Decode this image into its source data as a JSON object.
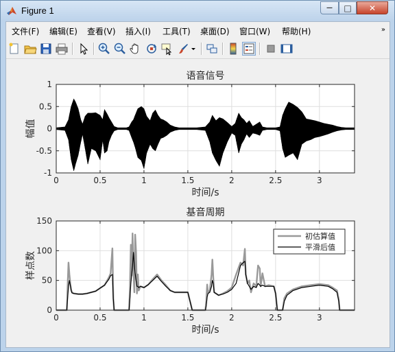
{
  "window": {
    "title": "Figure 1",
    "minimize_glyph": "—",
    "maximize_glyph": "□",
    "close_glyph": "✕"
  },
  "menu": [
    "文件(F)",
    "编辑(E)",
    "查看(V)",
    "插入(I)",
    "工具(T)",
    "桌面(D)",
    "窗口(W)",
    "帮助(H)"
  ],
  "menu_overflow_glyph": "»",
  "toolbar_icons": [
    "new-figure-icon",
    "open-file-icon",
    "save-icon",
    "print-icon",
    "edit-plot-arrow-icon",
    "zoom-in-icon",
    "zoom-out-icon",
    "pan-hand-icon",
    "rotate-3d-icon",
    "data-cursor-icon",
    "brush-icon",
    "link-plot-icon",
    "colorbar-icon",
    "legend-icon",
    "hide-plot-tools-icon",
    "show-plot-tools-icon"
  ],
  "chart_data": [
    {
      "type": "line",
      "title": "语音信号",
      "xlabel": "时间/s",
      "ylabel": "幅值",
      "xlim": [
        0,
        3.4
      ],
      "ylim": [
        -1,
        1
      ],
      "xticks": [
        0,
        0.5,
        1,
        1.5,
        2,
        2.5,
        3
      ],
      "xtick_labels": [
        "0",
        "0.5",
        "1",
        "1.5",
        "2",
        "2.5",
        "3"
      ],
      "yticks": [
        -1,
        -0.5,
        0,
        0.5,
        1
      ],
      "ytick_labels": [
        "-1",
        "-0.5",
        "0",
        "0.5",
        "1"
      ],
      "grid": true,
      "series_color": "#000000",
      "envelope": {
        "t": [
          0,
          0.1,
          0.14,
          0.17,
          0.2,
          0.22,
          0.25,
          0.28,
          0.3,
          0.33,
          0.36,
          0.4,
          0.45,
          0.5,
          0.53,
          0.55,
          0.58,
          0.6,
          0.63,
          0.66,
          0.7,
          0.75,
          0.8,
          0.83,
          0.86,
          0.88,
          0.9,
          0.93,
          0.97,
          1.0,
          1.03,
          1.07,
          1.1,
          1.13,
          1.16,
          1.19,
          1.22,
          1.26,
          1.3,
          1.35,
          1.4,
          1.5,
          1.6,
          1.7,
          1.75,
          1.78,
          1.82,
          1.86,
          1.9,
          1.95,
          2.0,
          2.04,
          2.08,
          2.11,
          2.14,
          2.17,
          2.2,
          2.24,
          2.28,
          2.32,
          2.35,
          2.4,
          2.5,
          2.55,
          2.58,
          2.61,
          2.65,
          2.7,
          2.75,
          2.8,
          2.85,
          2.9,
          2.95,
          3.0,
          3.05,
          3.1,
          3.15,
          3.2,
          3.25,
          3.3,
          3.4
        ],
        "upper": [
          0.02,
          0.04,
          0.2,
          0.5,
          0.67,
          0.6,
          0.45,
          0.2,
          0.1,
          0.28,
          0.35,
          0.35,
          0.36,
          0.3,
          0.2,
          0.43,
          0.33,
          0.25,
          0.15,
          0.05,
          0.02,
          0.02,
          0.02,
          0.04,
          0.15,
          0.2,
          0.3,
          0.45,
          0.5,
          0.45,
          0.28,
          0.18,
          0.35,
          0.42,
          0.3,
          0.22,
          0.2,
          0.15,
          0.08,
          0.04,
          0.02,
          0.02,
          0.02,
          0.04,
          0.15,
          0.3,
          0.18,
          0.25,
          0.22,
          0.14,
          0.05,
          0.12,
          0.35,
          0.25,
          0.2,
          0.12,
          0.18,
          0.05,
          0.1,
          0.15,
          0.04,
          0.02,
          0.02,
          0.04,
          0.3,
          0.45,
          0.6,
          0.55,
          0.48,
          0.38,
          0.22,
          0.2,
          0.18,
          0.15,
          0.12,
          0.1,
          0.08,
          0.05,
          0.03,
          0.02,
          0.02
        ],
        "lower": [
          -0.02,
          -0.04,
          -0.25,
          -0.7,
          -0.95,
          -0.8,
          -0.6,
          -0.3,
          -0.12,
          -0.45,
          -0.8,
          -0.45,
          -0.5,
          -0.7,
          -0.25,
          -0.55,
          -0.5,
          -0.3,
          -0.15,
          -0.05,
          -0.02,
          -0.02,
          -0.02,
          -0.04,
          -0.2,
          -0.3,
          -0.42,
          -0.65,
          -0.72,
          -0.9,
          -0.55,
          -0.35,
          -0.45,
          -0.5,
          -0.35,
          -0.22,
          -0.2,
          -0.15,
          -0.08,
          -0.04,
          -0.02,
          -0.02,
          -0.02,
          -0.04,
          -0.3,
          -0.55,
          -0.72,
          -0.85,
          -0.55,
          -0.3,
          -0.1,
          -0.15,
          -0.55,
          -0.35,
          -0.25,
          -0.12,
          -0.2,
          -0.1,
          -0.12,
          -0.15,
          -0.04,
          -0.02,
          -0.02,
          -0.05,
          -0.45,
          -0.65,
          -0.6,
          -0.55,
          -0.7,
          -0.35,
          -0.28,
          -0.25,
          -0.2,
          -0.18,
          -0.15,
          -0.12,
          -0.08,
          -0.05,
          -0.03,
          -0.02,
          -0.02
        ]
      }
    },
    {
      "type": "line",
      "title": "基音周期",
      "xlabel": "时间/s",
      "ylabel": "样点数",
      "xlim": [
        0,
        3.4
      ],
      "ylim": [
        0,
        150
      ],
      "xticks": [
        0,
        0.5,
        1,
        1.5,
        2,
        2.5,
        3
      ],
      "xtick_labels": [
        "0",
        "0.5",
        "1",
        "1.5",
        "2",
        "2.5",
        "3"
      ],
      "yticks": [
        0,
        50,
        100,
        150
      ],
      "ytick_labels": [
        "0",
        "50",
        "100",
        "150"
      ],
      "grid": true,
      "legend_position": "top-right",
      "series": [
        {
          "name": "初估算值",
          "color": "#999999",
          "x": [
            0,
            0.12,
            0.13,
            0.14,
            0.15,
            0.16,
            0.17,
            0.18,
            0.2,
            0.25,
            0.3,
            0.35,
            0.4,
            0.45,
            0.5,
            0.55,
            0.6,
            0.62,
            0.64,
            0.65,
            0.66,
            0.67,
            0.7,
            0.8,
            0.83,
            0.84,
            0.85,
            0.86,
            0.87,
            0.88,
            0.89,
            0.9,
            0.91,
            0.92,
            0.93,
            0.94,
            0.96,
            1.0,
            1.05,
            1.1,
            1.15,
            1.2,
            1.25,
            1.3,
            1.35,
            1.4,
            1.45,
            1.5,
            1.55,
            1.7,
            1.71,
            1.72,
            1.73,
            1.75,
            1.77,
            1.78,
            1.79,
            1.8,
            1.85,
            1.9,
            1.95,
            2.0,
            2.05,
            2.1,
            2.13,
            2.15,
            2.16,
            2.18,
            2.2,
            2.22,
            2.25,
            2.28,
            2.3,
            2.32,
            2.33,
            2.35,
            2.38,
            2.42,
            2.48,
            2.5,
            2.52,
            2.53,
            2.55,
            2.57,
            2.58,
            2.6,
            2.63,
            2.7,
            2.8,
            2.9,
            3.0,
            3.1,
            3.15,
            3.2,
            3.22,
            3.23,
            3.24,
            3.4
          ],
          "y": [
            0,
            0,
            40,
            80,
            60,
            45,
            34,
            30,
            28,
            27,
            27,
            28,
            30,
            32,
            37,
            42,
            55,
            62,
            104,
            20,
            0,
            0,
            0,
            0,
            0,
            40,
            110,
            58,
            129,
            65,
            30,
            127,
            98,
            28,
            60,
            33,
            40,
            38,
            43,
            52,
            60,
            50,
            42,
            33,
            30,
            30,
            30,
            30,
            0,
            0,
            16,
            43,
            30,
            33,
            60,
            85,
            55,
            30,
            25,
            28,
            32,
            38,
            60,
            80,
            75,
            103,
            60,
            45,
            50,
            30,
            45,
            40,
            75,
            70,
            40,
            62,
            40,
            42,
            40,
            28,
            0,
            0,
            0,
            0,
            0,
            20,
            28,
            35,
            40,
            42,
            44,
            42,
            38,
            33,
            18,
            0,
            0,
            0
          ]
        },
        {
          "name": "平滑后值",
          "color": "#000000",
          "x": [
            0,
            0.12,
            0.13,
            0.14,
            0.15,
            0.16,
            0.17,
            0.18,
            0.2,
            0.25,
            0.3,
            0.35,
            0.4,
            0.45,
            0.5,
            0.55,
            0.6,
            0.62,
            0.64,
            0.65,
            0.66,
            0.67,
            0.7,
            0.8,
            0.83,
            0.84,
            0.85,
            0.86,
            0.87,
            0.88,
            0.89,
            0.9,
            0.91,
            0.92,
            0.93,
            0.94,
            0.96,
            1.0,
            1.05,
            1.1,
            1.15,
            1.2,
            1.25,
            1.3,
            1.35,
            1.4,
            1.45,
            1.5,
            1.55,
            1.7,
            1.71,
            1.72,
            1.73,
            1.75,
            1.77,
            1.78,
            1.79,
            1.8,
            1.85,
            1.9,
            1.95,
            2.0,
            2.05,
            2.1,
            2.13,
            2.15,
            2.16,
            2.18,
            2.2,
            2.22,
            2.25,
            2.28,
            2.3,
            2.32,
            2.33,
            2.35,
            2.38,
            2.42,
            2.48,
            2.5,
            2.52,
            2.53,
            2.55,
            2.57,
            2.58,
            2.6,
            2.63,
            2.7,
            2.8,
            2.9,
            3.0,
            3.1,
            3.15,
            3.2,
            3.22,
            3.23,
            3.24,
            3.4
          ],
          "y": [
            0,
            0,
            20,
            40,
            50,
            42,
            33,
            29,
            28,
            27,
            27,
            28,
            30,
            32,
            37,
            42,
            52,
            58,
            60,
            20,
            0,
            0,
            0,
            0,
            0,
            20,
            45,
            60,
            75,
            97,
            75,
            62,
            50,
            40,
            40,
            38,
            40,
            38,
            43,
            50,
            57,
            48,
            40,
            33,
            30,
            30,
            30,
            30,
            0,
            0,
            8,
            22,
            28,
            30,
            40,
            50,
            45,
            30,
            25,
            27,
            30,
            35,
            45,
            75,
            80,
            82,
            60,
            45,
            40,
            35,
            40,
            38,
            45,
            42,
            40,
            42,
            40,
            40,
            40,
            28,
            0,
            0,
            0,
            0,
            0,
            15,
            25,
            33,
            38,
            40,
            42,
            40,
            36,
            30,
            15,
            0,
            0,
            0
          ]
        }
      ]
    }
  ]
}
